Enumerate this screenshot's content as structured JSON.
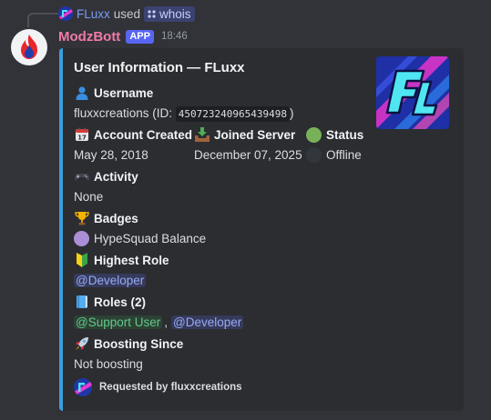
{
  "reply": {
    "username": "FLuxx",
    "action_text": "used",
    "command": "whois"
  },
  "message": {
    "author": "ModzBott",
    "badge": "APP",
    "timestamp": "18:46"
  },
  "embed": {
    "accent_color": "#3a9fde",
    "title": "User Information — FLuxx",
    "fields": {
      "username": {
        "icon": "bust-in-silhouette-icon",
        "name": "Username",
        "value_prefix": "fluxxcreations (ID: ",
        "value_code": "450723240965439498",
        "value_suffix": ")"
      },
      "account_created": {
        "icon": "calendar-icon",
        "name": "Account Created",
        "value": "May 28, 2018"
      },
      "joined_server": {
        "icon": "inbox-tray-icon",
        "name": "Joined Server",
        "value": "December 07, 2025"
      },
      "status": {
        "icon": "green-circle-icon",
        "name": "Status",
        "value": "Offline",
        "value_icon": "black-circle-icon"
      },
      "activity": {
        "icon": "video-game-icon",
        "name": "Activity",
        "value": "None"
      },
      "badges": {
        "icon": "trophy-icon",
        "name": "Badges",
        "value": "HypeSquad Balance",
        "value_icon": "purple-circle-icon"
      },
      "highest_role": {
        "icon": "beginner-icon",
        "name": "Highest Role",
        "value": "@Developer"
      },
      "roles": {
        "icon": "blue-book-icon",
        "name": "Roles (2)",
        "values": [
          "@Support User",
          "@Developer"
        ],
        "separator": ","
      },
      "boosting": {
        "icon": "rocket-icon",
        "name": "Boosting Since",
        "value": "Not boosting"
      }
    },
    "footer": {
      "text": "Requested by fluxxcreations"
    }
  }
}
